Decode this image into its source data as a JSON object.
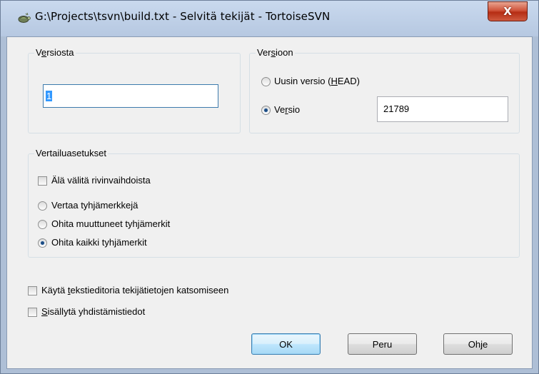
{
  "window": {
    "title": "G:\\Projects\\tsvn\\build.txt - Selvitä tekijät - TortoiseSVN",
    "close_label": "X"
  },
  "from_group": {
    "legend_pre": "V",
    "legend_u": "e",
    "legend_post": "rsiosta",
    "value": "1"
  },
  "to_group": {
    "legend_pre": "Ver",
    "legend_u": "s",
    "legend_post": "ioon",
    "head_label_pre": "Uusin versio (",
    "head_label_u": "H",
    "head_label_post": "EAD)",
    "head_checked": false,
    "revision_label_pre": "Ve",
    "revision_label_u": "r",
    "revision_label_post": "sio",
    "revision_checked": true,
    "revision_value": "21789"
  },
  "compare_group": {
    "legend": "Vertailuasetukset",
    "ignore_eol_label": "Älä välitä rivinvaihdoista",
    "ignore_eol_checked": false,
    "whitespace_options": [
      {
        "label": "Vertaa tyhjämerkkejä",
        "checked": false
      },
      {
        "label": "Ohita muuttuneet tyhjämerkit",
        "checked": false
      },
      {
        "label": "Ohita kaikki tyhjämerkit",
        "checked": true
      }
    ]
  },
  "options": {
    "text_viewer_pre": "Käytä ",
    "text_viewer_u": "t",
    "text_viewer_post": "ekstieditoria tekijätietojen katsomiseen",
    "text_viewer_checked": false,
    "merge_info_pre": "",
    "merge_info_u": "S",
    "merge_info_post": "isällytä yhdistämistiedot",
    "merge_info_checked": false
  },
  "buttons": {
    "ok": "OK",
    "cancel": "Peru",
    "help": "Ohje"
  }
}
